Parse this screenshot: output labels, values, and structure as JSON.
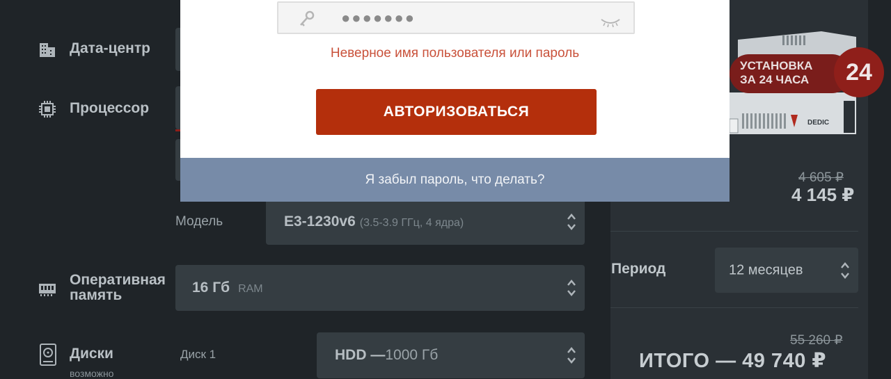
{
  "config": {
    "datacenter_label": "Дата-центр",
    "processor_label": "Процессор",
    "model_label": "Модель",
    "model_value": "E3-1230v6",
    "model_hint": "(3.5-3.9 ГГц, 4 ядра)",
    "ram_label_line1": "Оперативная",
    "ram_label_line2": "память",
    "ram_value": "16 Гб",
    "ram_hint": "RAM",
    "disks_label": "Диски",
    "disks_sub": "возможно",
    "disk1_label": "Диск 1",
    "disk1_type": "HDD —",
    "disk1_size": "1000 Гб"
  },
  "summary": {
    "old_price": "4 605 ₽",
    "price": "4 145 ₽",
    "period_label": "Период",
    "period_value": "12 месяцев",
    "total_old": "55 260 ₽",
    "total": "ИТОГО — 49 740 ₽"
  },
  "promo": {
    "line1": "УСТАНОВКА",
    "line2": "ЗА 24 ЧАСА",
    "badge": "24",
    "brand": "DEDIC"
  },
  "modal": {
    "password_value": "●●●●●●●",
    "error_text": "Неверное имя пользователя или пароль",
    "auth_button": "АВТОРИЗОВАТЬСЯ",
    "forgot_link": "Я забыл пароль, что делать?"
  },
  "colors": {
    "background": "#1f2428",
    "panel": "#2a3035",
    "select": "#353d42",
    "accent": "#b42f0c",
    "error": "#c9513a",
    "forgot_bar": "#778ba8"
  }
}
